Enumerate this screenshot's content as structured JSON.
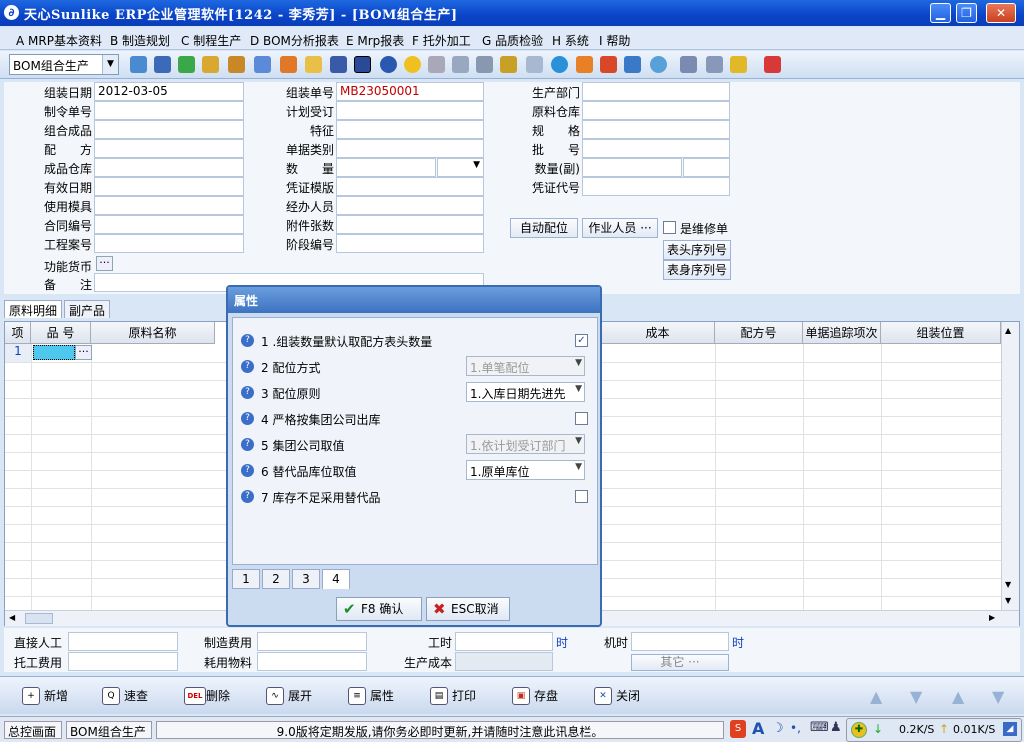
{
  "window": {
    "title": "天心Sunlike ERP企业管理软件[1242 - 李秀芳] - [BOM组合生产]"
  },
  "menu": [
    "A MRP基本资料",
    "B 制造规划",
    "C 制程生产",
    "D BOM分析报表",
    "E Mrp报表",
    "F 托外加工",
    "G 品质检验",
    "H 系统",
    "I 帮助"
  ],
  "toolbar": {
    "combo_value": "BOM组合生产"
  },
  "form": {
    "col1": [
      {
        "label": "组装日期",
        "value": "2012-03-05"
      },
      {
        "label": "制令单号",
        "value": ""
      },
      {
        "label": "组合成品",
        "value": ""
      },
      {
        "label": "配　　方",
        "value": ""
      },
      {
        "label": "成品仓库",
        "value": ""
      },
      {
        "label": "有效日期",
        "value": ""
      },
      {
        "label": "使用模具",
        "value": ""
      },
      {
        "label": "合同编号",
        "value": ""
      },
      {
        "label": "工程案号",
        "value": ""
      }
    ],
    "col2": [
      {
        "label": "组装单号",
        "value": "MB23050001"
      },
      {
        "label": "计划受订",
        "value": ""
      },
      {
        "label": "特征",
        "value": ""
      },
      {
        "label": "单据类别",
        "value": ""
      },
      {
        "label": "数　　量",
        "value": ""
      },
      {
        "label": "凭证模版",
        "value": ""
      },
      {
        "label": "经办人员",
        "value": ""
      },
      {
        "label": "附件张数",
        "value": ""
      },
      {
        "label": "阶段编号",
        "value": ""
      }
    ],
    "col3": [
      {
        "label": "生产部门",
        "value": ""
      },
      {
        "label": "原料仓库",
        "value": ""
      },
      {
        "label": "规　　格",
        "value": ""
      },
      {
        "label": "批　　号",
        "value": ""
      },
      {
        "label": "数量(副)",
        "value": ""
      },
      {
        "label": "凭证代号",
        "value": ""
      }
    ],
    "func_currency_label": "功能货币",
    "remark_label": "备　　注",
    "auto_alloc_button": "自动配位",
    "worker_button": "作业人员",
    "repair_label": "是维修单",
    "header_seq_button": "表头序列号",
    "body_seq_button": "表身序列号"
  },
  "tabs": [
    "原料明细",
    "副产品"
  ],
  "grid": {
    "columns": [
      "项",
      "品 号",
      "原料名称",
      "成本",
      "配方号",
      "单据追踪项次",
      "组装位置"
    ],
    "rows": [
      {
        "no": "1"
      }
    ]
  },
  "footer": {
    "direct_labor_label": "直接人工",
    "outsource_fee_label": "托工费用",
    "manufacture_fee_label": "制造费用",
    "material_consumption_label": "耗用物料",
    "work_hours_label": "工时",
    "production_cost_label": "生产成本",
    "machine_hours_label": "机时",
    "hours_unit": "时",
    "other_button": "其它 ···"
  },
  "bottom_buttons": [
    "新增",
    "速查",
    "删除",
    "展开",
    "属性",
    "打印",
    "存盘",
    "关闭"
  ],
  "bottom_icons": [
    "+",
    "Q",
    "DEL",
    "∿",
    "≡",
    "▤",
    "▣",
    "✕"
  ],
  "status": {
    "item1": "总控画面",
    "item2": "BOM组合生产",
    "message": "9.0版将定期发版,请你务必即时更新,并请随时注意此讯息栏。",
    "down_speed": "0.2K/S",
    "up_speed": "0.01K/S"
  },
  "dialog": {
    "title": "属性",
    "props": [
      {
        "label": "1 .组装数量默认取配方表头数量",
        "type": "checkbox",
        "checked": "✓"
      },
      {
        "label": "2 配位方式",
        "type": "select",
        "value": "1.单笔配位",
        "disabled": true
      },
      {
        "label": "3 配位原则",
        "type": "select",
        "value": "1.入库日期先进先",
        "disabled": false
      },
      {
        "label": "4 严格按集团公司出库",
        "type": "checkbox",
        "checked": ""
      },
      {
        "label": "5 集团公司取值",
        "type": "select",
        "value": "1.依计划受订部门",
        "disabled": true
      },
      {
        "label": "6 替代品库位取值",
        "type": "select",
        "value": "1.原单库位",
        "disabled": false
      },
      {
        "label": "7 库存不足采用替代品",
        "type": "checkbox",
        "checked": ""
      }
    ],
    "tabs": [
      "1",
      "2",
      "3",
      "4"
    ],
    "ok_button": "F8 确认",
    "cancel_button": "ESC取消"
  }
}
